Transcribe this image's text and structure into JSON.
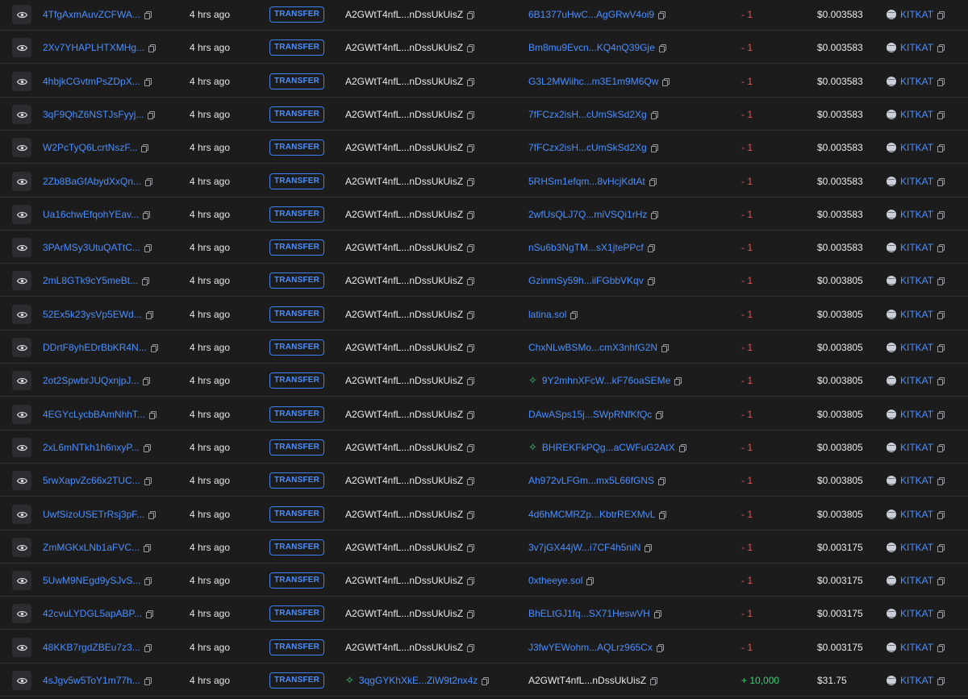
{
  "action_label": "TRANSFER",
  "time_label": "4 hrs ago",
  "token": {
    "symbol": "KITKAT"
  },
  "icons": {
    "view": "eye-icon",
    "copy": "copy-icon",
    "program": "sparkle-icon",
    "token": "token-coin-icon"
  },
  "colors": {
    "link": "#4b8fff",
    "negative": "#ef5350",
    "positive": "#3ecf72",
    "background": "#1c1c1d"
  },
  "rows": [
    {
      "sig": "4TfgAxmAuvZCFWA...",
      "from": "A2GWtT4nfL...nDssUkUisZ",
      "to": "6B1377uHwC...AgGRwV4oi9",
      "amount": "- 1",
      "value": "$0.003583"
    },
    {
      "sig": "2Xv7YHAPLHTXMHg...",
      "from": "A2GWtT4nfL...nDssUkUisZ",
      "to": "Bm8mu9Evcn...KQ4nQ39Gje",
      "amount": "- 1",
      "value": "$0.003583"
    },
    {
      "sig": "4hbjkCGvtmPsZDpX...",
      "from": "A2GWtT4nfL...nDssUkUisZ",
      "to": "G3L2MWiihc...m3E1m9M6Qw",
      "amount": "- 1",
      "value": "$0.003583"
    },
    {
      "sig": "3qF9QhZ6NSTJsFyyj...",
      "from": "A2GWtT4nfL...nDssUkUisZ",
      "to": "7fFCzx2isH...cUmSkSd2Xg",
      "amount": "- 1",
      "value": "$0.003583"
    },
    {
      "sig": "W2PcTyQ6LcrtNszF...",
      "from": "A2GWtT4nfL...nDssUkUisZ",
      "to": "7fFCzx2isH...cUmSkSd2Xg",
      "amount": "- 1",
      "value": "$0.003583"
    },
    {
      "sig": "2Zb8BaGfAbydXxQn...",
      "from": "A2GWtT4nfL...nDssUkUisZ",
      "to": "5RHSm1efqm...8vHcjKdtAt",
      "amount": "- 1",
      "value": "$0.003583"
    },
    {
      "sig": "Ua16chwEfqohYEav...",
      "from": "A2GWtT4nfL...nDssUkUisZ",
      "to": "2wfUsQLJ7Q...miVSQi1rHz",
      "amount": "- 1",
      "value": "$0.003583"
    },
    {
      "sig": "3PArMSy3UtuQATtC...",
      "from": "A2GWtT4nfL...nDssUkUisZ",
      "to": "nSu6b3NgTM...sX1jtePPcf",
      "amount": "- 1",
      "value": "$0.003583"
    },
    {
      "sig": "2mL8GTk9cY5meBt...",
      "from": "A2GWtT4nfL...nDssUkUisZ",
      "to": "GzinmSy59h...iiFGbbVKqv",
      "amount": "- 1",
      "value": "$0.003805"
    },
    {
      "sig": "52Ex5k23ysVp5EWd...",
      "from": "A2GWtT4nfL...nDssUkUisZ",
      "to": "latina.sol",
      "amount": "- 1",
      "value": "$0.003805"
    },
    {
      "sig": "DDrtF8yhEDrBbKR4N...",
      "from": "A2GWtT4nfL...nDssUkUisZ",
      "to": "ChxNLwBSMo...cmX3nhfG2N",
      "amount": "- 1",
      "value": "$0.003805"
    },
    {
      "sig": "2ot2SpwbrJUQxnjpJ...",
      "from": "A2GWtT4nfL...nDssUkUisZ",
      "to": "9Y2mhnXFcW...kF76oaSEMe",
      "to_program": true,
      "amount": "- 1",
      "value": "$0.003805"
    },
    {
      "sig": "4EGYcLycbBAmNhhT...",
      "from": "A2GWtT4nfL...nDssUkUisZ",
      "to": "DAwASps15j...SWpRNfKfQc",
      "amount": "- 1",
      "value": "$0.003805"
    },
    {
      "sig": "2xL6mNTkh1h6nxyP...",
      "from": "A2GWtT4nfL...nDssUkUisZ",
      "to": "BHREKFkPQg...aCWFuG2AtX",
      "to_program": true,
      "amount": "- 1",
      "value": "$0.003805"
    },
    {
      "sig": "5rwXapvZc66x2TUC...",
      "from": "A2GWtT4nfL...nDssUkUisZ",
      "to": "Ah972vLFGm...mx5L66fGNS",
      "amount": "- 1",
      "value": "$0.003805"
    },
    {
      "sig": "UwfSizoUSETrRsj3pF...",
      "from": "A2GWtT4nfL...nDssUkUisZ",
      "to": "4d6hMCMRZp...KbtrREXMvL",
      "amount": "- 1",
      "value": "$0.003805"
    },
    {
      "sig": "ZmMGKxLNb1aFVC...",
      "from": "A2GWtT4nfL...nDssUkUisZ",
      "to": "3v7jGX44jW...i7CF4h5niN",
      "amount": "- 1",
      "value": "$0.003175"
    },
    {
      "sig": "5UwM9NEgd9ySJvS...",
      "from": "A2GWtT4nfL...nDssUkUisZ",
      "to": "0xtheeye.sol",
      "amount": "- 1",
      "value": "$0.003175"
    },
    {
      "sig": "42cvuLYDGL5apABP...",
      "from": "A2GWtT4nfL...nDssUkUisZ",
      "to": "BhELtGJ1fq...SX71HeswVH",
      "amount": "- 1",
      "value": "$0.003175"
    },
    {
      "sig": "48KKB7rgdZBEu7z3...",
      "from": "A2GWtT4nfL...nDssUkUisZ",
      "to": "J3fwYEWohm...AQLrz965Cx",
      "amount": "- 1",
      "value": "$0.003175"
    },
    {
      "sig": "4sJgv5w5ToY1m77h...",
      "from": "3qgGYKhXkE...ZiW9t2nx4z",
      "from_program": true,
      "to": "A2GWtT4nfL...nDssUkUisZ",
      "to_plain": true,
      "amount": "+ 10,000",
      "value": "$31.75"
    }
  ]
}
